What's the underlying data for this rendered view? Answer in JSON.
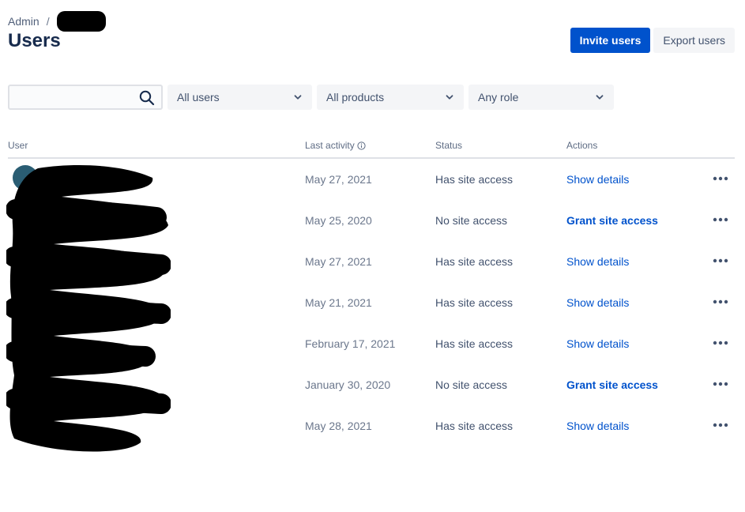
{
  "breadcrumb": {
    "root": "Admin",
    "separator": "/"
  },
  "page": {
    "title": "Users"
  },
  "actions": {
    "invite_label": "Invite users",
    "export_label": "Export users"
  },
  "filters": {
    "search": {
      "placeholder": "",
      "value": ""
    },
    "users": "All users",
    "products": "All products",
    "role": "Any role"
  },
  "table": {
    "headers": {
      "user": "User",
      "last_activity": "Last activity",
      "status": "Status",
      "actions": "Actions"
    },
    "rows": [
      {
        "last_activity": "May 27, 2021",
        "status": "Has site access",
        "action": "Show details"
      },
      {
        "last_activity": "May 25, 2020",
        "status": "No site access",
        "action": "Grant site access"
      },
      {
        "last_activity": "May 27, 2021",
        "status": "Has site access",
        "action": "Show details"
      },
      {
        "last_activity": "May 21, 2021",
        "status": "Has site access",
        "action": "Show details"
      },
      {
        "last_activity": "February 17, 2021",
        "status": "Has site access",
        "action": "Show details"
      },
      {
        "last_activity": "January 30, 2020",
        "status": "No site access",
        "action": "Grant site access"
      },
      {
        "last_activity": "May 28, 2021",
        "status": "Has site access",
        "action": "Show details"
      }
    ]
  },
  "colors": {
    "primary": "#0052cc",
    "text": "#172b4d",
    "muted": "#6b778c",
    "border": "#dfe1e6"
  },
  "icons": {
    "search": "search-icon",
    "chevron": "chevron-down-icon",
    "info": "info-icon",
    "more": "more-horizontal-icon"
  }
}
